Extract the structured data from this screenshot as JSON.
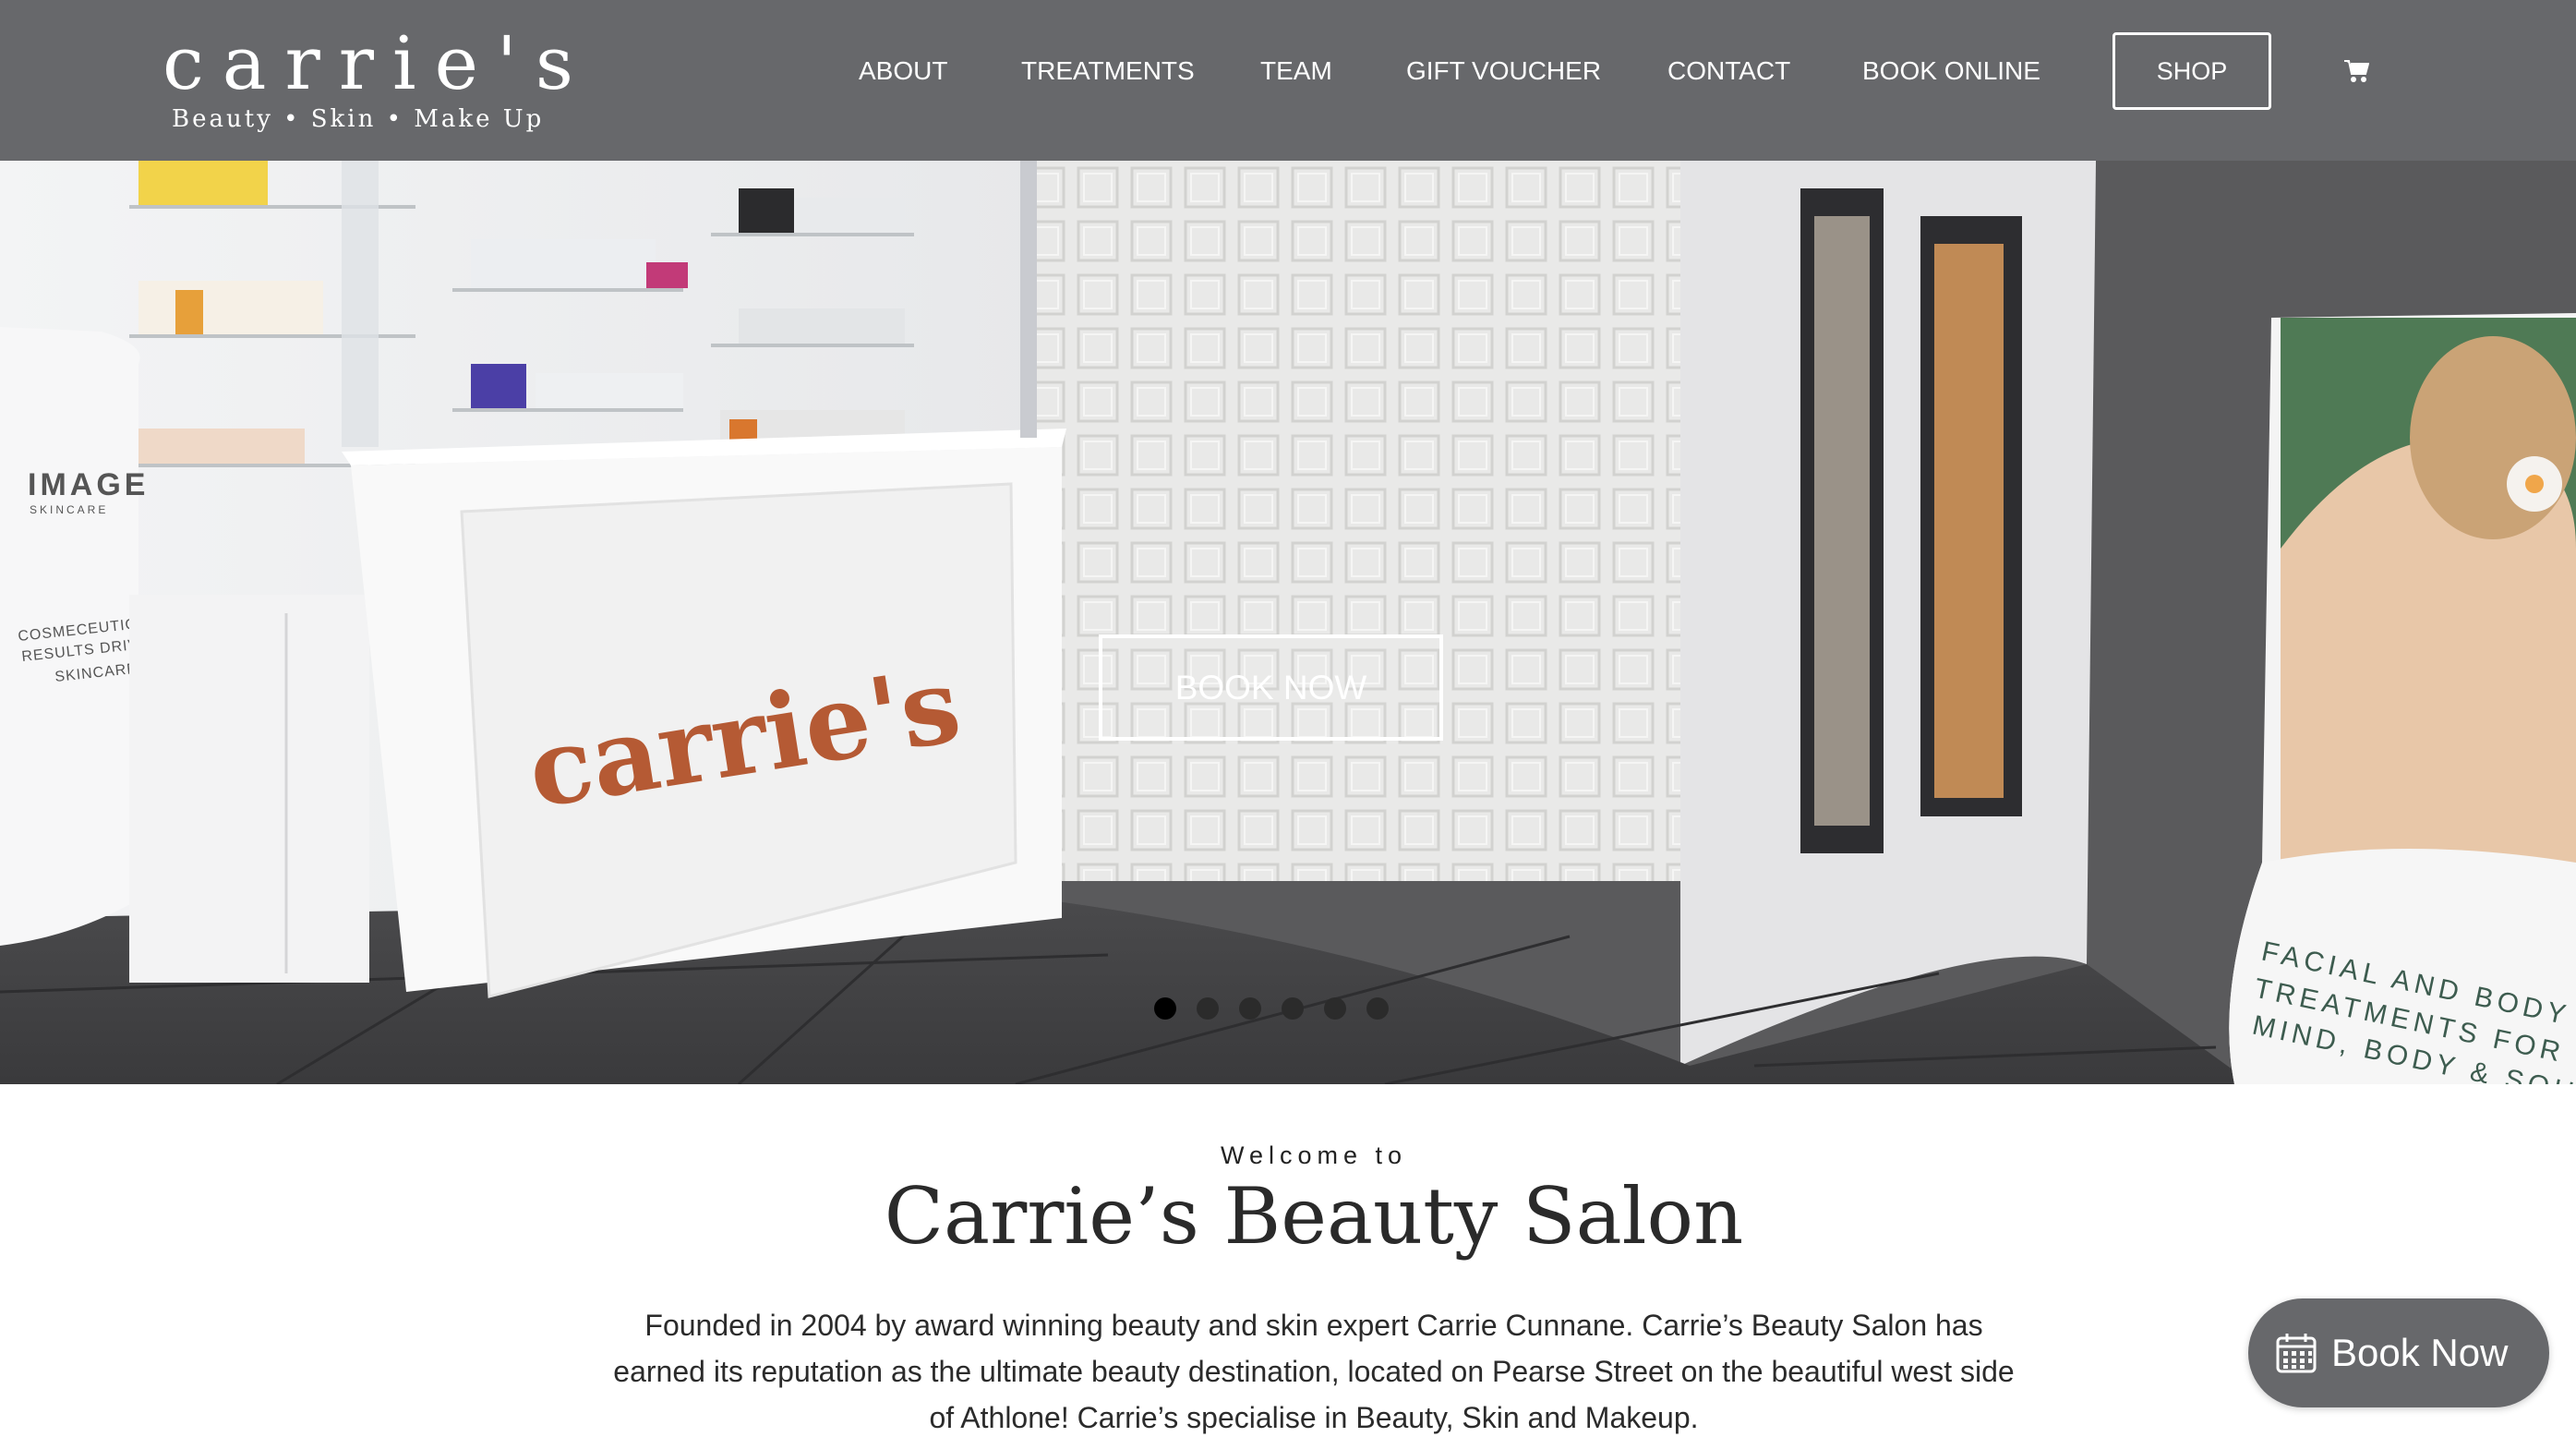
{
  "brand": {
    "logo_text": "carrie's",
    "tagline": "Beauty  •  Skin  •  Make Up"
  },
  "nav": {
    "items": [
      {
        "label": "ABOUT"
      },
      {
        "label": "TREATMENTS"
      },
      {
        "label": "TEAM"
      },
      {
        "label": "GIFT VOUCHER"
      },
      {
        "label": "CONTACT"
      },
      {
        "label": "BOOK ONLINE"
      }
    ],
    "shop_label": "SHOP",
    "cart_icon": "cart-icon"
  },
  "hero": {
    "button_label": "BOOK NOW",
    "slides_count": 6,
    "active_slide": 1,
    "desk_logo": "carrie's",
    "poster_text": [
      "FACIAL AND BODY",
      "TREATMENTS FOR",
      "MIND, BODY & SOUL"
    ],
    "image_sign": [
      "IMAGE",
      "SKINCARE",
      "COSMECEUTICAL",
      "RESULTS DRIVEN",
      "SKINCARE"
    ]
  },
  "welcome": {
    "small": "Welcome to",
    "title": "Carrie’s Beauty Salon",
    "body": "Founded in 2004 by award winning beauty and skin expert Carrie Cunnane. Carrie’s Beauty Salon has earned its reputation as the ultimate beauty destination, located on Pearse Street on the beautiful west side of Athlone! Carrie’s specialise in Beauty, Skin and Makeup."
  },
  "floating_book": {
    "label": "Book Now",
    "icon": "calendar-icon"
  },
  "colors": {
    "header_bg": "#67686b",
    "accent_rust": "#b55a34",
    "text_dark": "#2b2b2b"
  }
}
